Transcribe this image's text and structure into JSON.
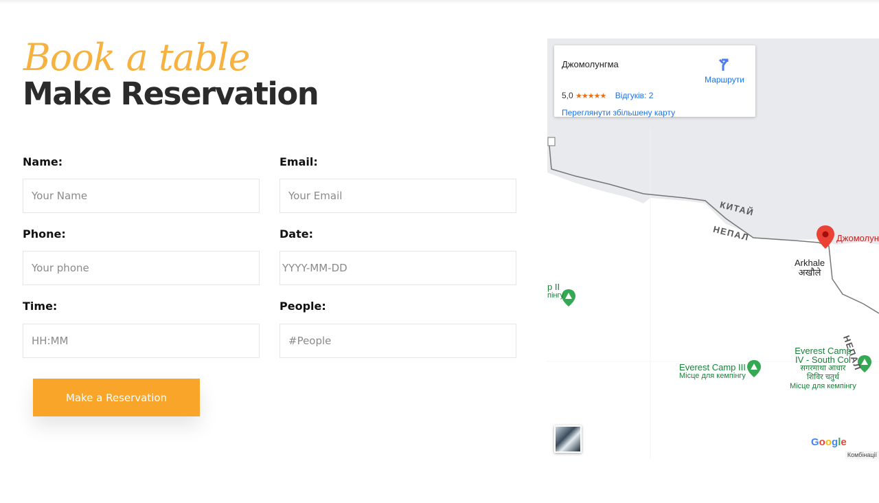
{
  "header": {
    "script_title": "Book a table",
    "title": "Make Reservation"
  },
  "form": {
    "name": {
      "label": "Name:",
      "placeholder": "Your Name"
    },
    "email": {
      "label": "Email:",
      "placeholder": "Your Email"
    },
    "phone": {
      "label": "Phone:",
      "placeholder": "Your phone"
    },
    "date": {
      "label": "Date:",
      "placeholder": "YYYY-MM-DD"
    },
    "time": {
      "label": "Time:",
      "placeholder": "HH:MM"
    },
    "people": {
      "label": "People:",
      "placeholder": "#People"
    },
    "submit_label": "Make a Reservation"
  },
  "map": {
    "card": {
      "place_name": "Джомолунгма",
      "rating": "5,0",
      "stars": "★★★★★",
      "reviews": "Відгуків: 2",
      "larger_map": "Переглянути збільшену карту",
      "directions": "Маршрути"
    },
    "labels": {
      "china": "КИТАЙ",
      "nepal": "НЕПАЛ",
      "nepal_right": "НЕПАЛ",
      "pin": "Джомолун",
      "village_latin": "Arkhale",
      "village_native": "अखौले",
      "camp2": "p II",
      "camp2_sub": "пінгу",
      "camp3": "Everest Camp III",
      "camp3_sub": "Місце для кемпінгу",
      "camp4_line1": "Everest Camp",
      "camp4_line2": "IV - South Col",
      "camp4_native1": "सगरमाथा आधार",
      "camp4_native2": "शिविर चतुर्थ",
      "camp4_sub": "Місце для кемпінгу"
    },
    "google": "Google",
    "attribution": "Комбінації",
    "colors": {
      "accent": "#f8a52a",
      "link": "#1a73e8",
      "poi": "#188038",
      "pin": "#ea4335"
    }
  }
}
